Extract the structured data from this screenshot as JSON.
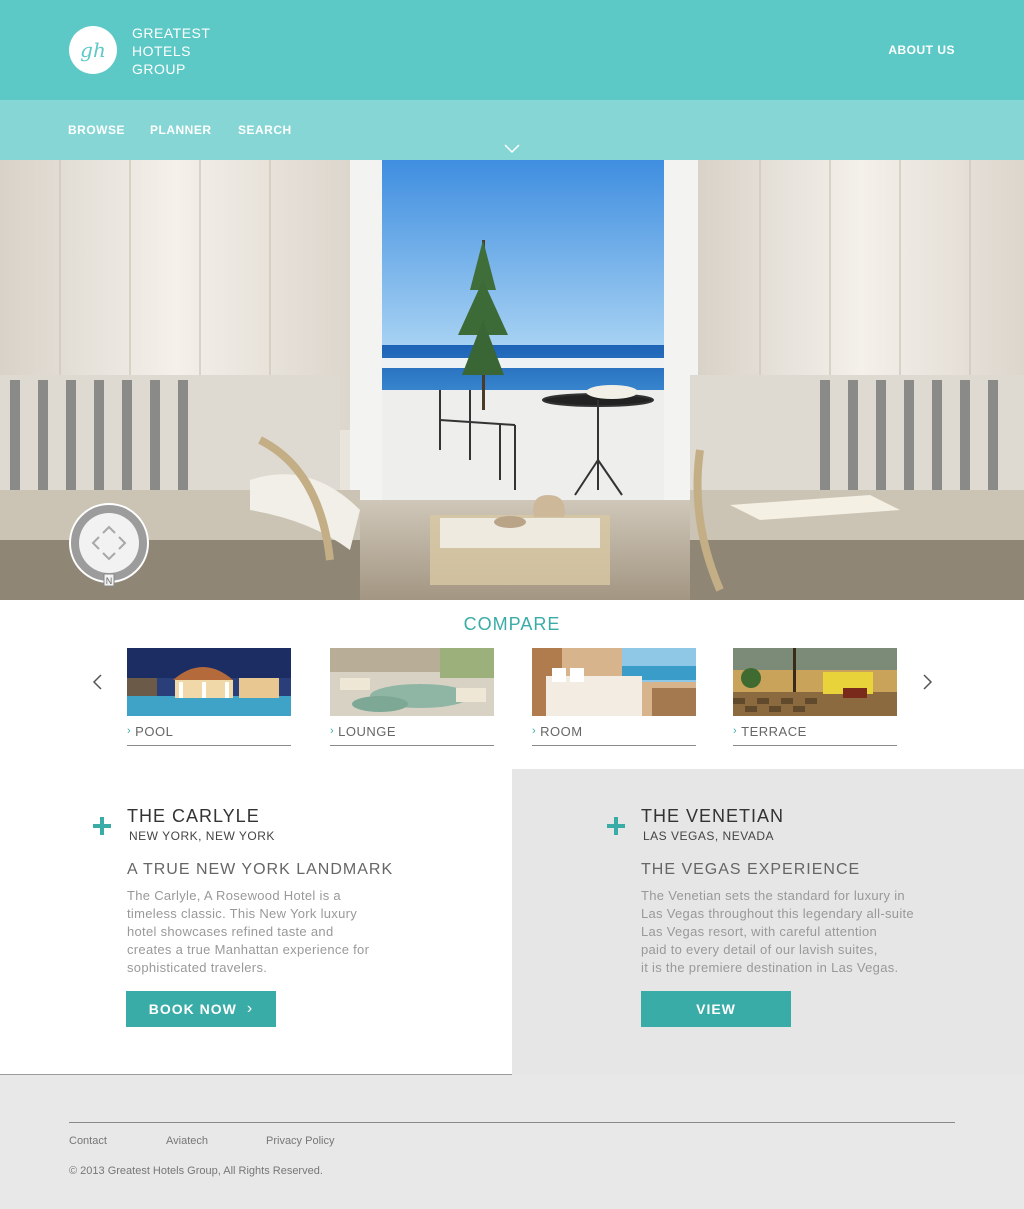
{
  "header": {
    "logo_monogram": "gh",
    "brand_lines": [
      "GREATEST",
      "HOTELS",
      "GROUP"
    ],
    "about_label": "ABOUT US"
  },
  "nav": {
    "items": [
      {
        "label": "BROWSE"
      },
      {
        "label": "PLANNER"
      },
      {
        "label": "SEARCH"
      }
    ]
  },
  "compass": {
    "north_label": "N"
  },
  "compare": {
    "title": "COMPARE",
    "items": [
      {
        "label": "POOL"
      },
      {
        "label": "LOUNGE"
      },
      {
        "label": "ROOM"
      },
      {
        "label": "TERRACE"
      }
    ]
  },
  "hotels": [
    {
      "name": "THE CARLYLE",
      "location": "NEW YORK, NEW YORK",
      "tagline": "A TRUE NEW YORK LANDMARK",
      "description": [
        "The Carlyle, A Rosewood Hotel is a",
        "timeless classic. This New York luxury",
        "hotel showcases refined taste and",
        "creates a true Manhattan experience for",
        "sophisticated travelers."
      ],
      "button": "BOOK NOW"
    },
    {
      "name": "THE VENETIAN",
      "location": "LAS VEGAS, NEVADA",
      "tagline": "THE VEGAS EXPERIENCE",
      "description": [
        "The Venetian sets the standard for luxury in",
        "Las Vegas throughout this legendary all-suite",
        "Las Vegas resort, with careful attention",
        "paid to every detail of our lavish suites,",
        "it is the premiere destination in Las Vegas."
      ],
      "button": "VIEW"
    }
  ],
  "footer": {
    "links": [
      "Contact",
      "Aviatech",
      "Privacy Policy"
    ],
    "copyright": "© 2013 Greatest Hotels Group, All Rights Reserved."
  },
  "colors": {
    "header_bg": "#5cc9c6",
    "nav_bg": "#85d6d4",
    "accent": "#3aaca8"
  }
}
